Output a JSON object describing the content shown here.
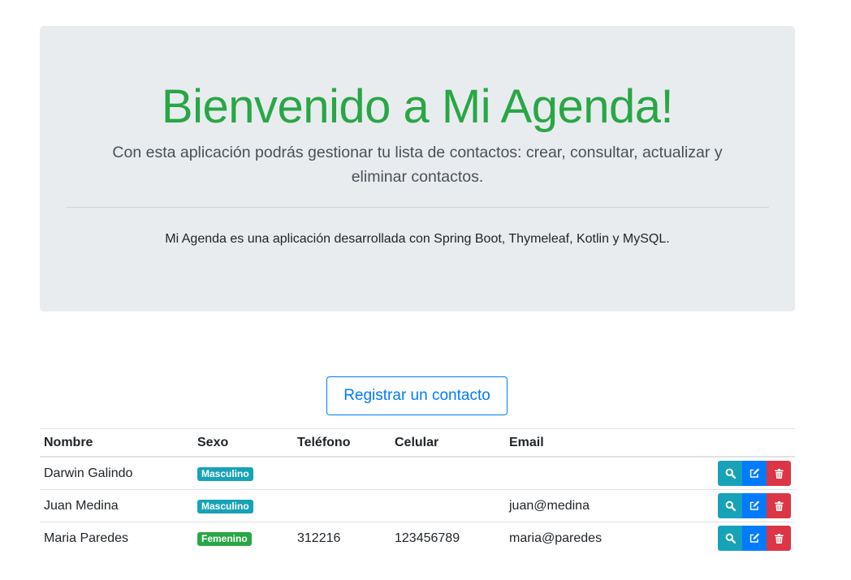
{
  "jumbotron": {
    "title": "Bienvenido a Mi Agenda!",
    "lead": "Con esta aplicación podrás gestionar tu lista de contactos: crear, consultar, actualizar y eliminar contactos.",
    "text": "Mi Agenda es una aplicación desarrollada con Spring Boot, Thymeleaf, Kotlin y MySQL."
  },
  "register_button": "Registrar un contacto",
  "table": {
    "headers": [
      "Nombre",
      "Sexo",
      "Teléfono",
      "Celular",
      "Email",
      ""
    ],
    "rows": [
      {
        "nombre": "Darwin Galindo",
        "sexo": "Masculino",
        "telefono": "",
        "celular": "",
        "email": ""
      },
      {
        "nombre": "Juan Medina",
        "sexo": "Masculino",
        "telefono": "",
        "celular": "",
        "email": "juan@medina"
      },
      {
        "nombre": "Maria Paredes",
        "sexo": "Femenino",
        "telefono": "312216",
        "celular": "123456789",
        "email": "maria@paredes"
      }
    ]
  },
  "colors": {
    "title": "#28a745",
    "badge_masculino": "#17a2b8",
    "badge_femenino": "#28a745",
    "view": "#17a2b8",
    "edit": "#007bff",
    "delete": "#dc3545"
  },
  "icons": {
    "view": "search-icon",
    "edit": "edit-icon",
    "delete": "trash-icon"
  }
}
